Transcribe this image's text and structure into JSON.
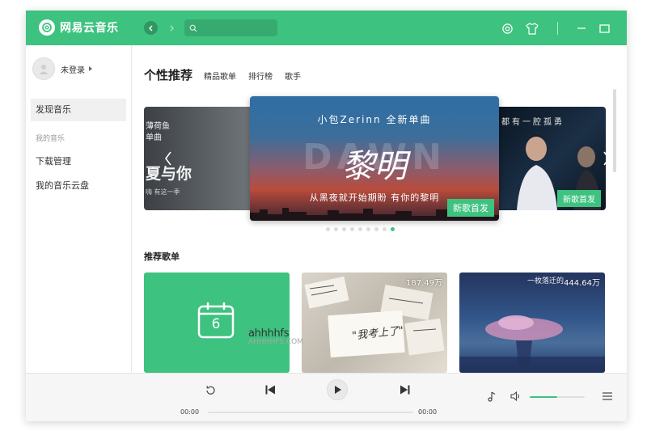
{
  "app": {
    "title": "网易云音乐"
  },
  "search": {
    "placeholder": ""
  },
  "sidebar": {
    "user_label": "未登录",
    "items": [
      {
        "label": "发现音乐"
      },
      {
        "label": "下载管理"
      },
      {
        "label": "我的音乐云盘"
      }
    ],
    "section_label": "我的音乐"
  },
  "main": {
    "tabs": [
      {
        "label": "个性推荐"
      },
      {
        "label": "精品歌单"
      },
      {
        "label": "排行榜"
      },
      {
        "label": "歌手"
      }
    ],
    "banner": {
      "left": {
        "line1": "薄荷鱼",
        "line2": "单曲",
        "title": "夏与你",
        "subtitle": "嗨 有这一季"
      },
      "center": {
        "headline": "小包Zerinn  全新单曲",
        "title": "黎明",
        "subtitle": "从黑夜就开始期盼  有你的黎明",
        "bg_word": "DAWN",
        "tag": "新歌首发"
      },
      "right": {
        "headline": "人都有一腔孤勇",
        "tag": "新歌首发"
      },
      "dot_count": 9,
      "active_dot": 8
    },
    "section_title": "推荐歌单",
    "cards": [
      {
        "type": "daily",
        "day": "6"
      },
      {
        "type": "playlist",
        "playcount": "187.49万",
        "handwriting": "\"我考上了\""
      },
      {
        "type": "playlist",
        "playcount": "444.64万",
        "caption": "一枚落迁的"
      }
    ]
  },
  "player": {
    "elapsed": "00:00",
    "duration": "00:00",
    "volume": 0.5
  },
  "watermark": {
    "line1": "ahhhhfs",
    "line2": "AHHHHFS.COM"
  },
  "colors": {
    "accent": "#3ec27f",
    "player_bg": "#f6f6f6"
  },
  "icons": [
    "logo-icon",
    "back-icon",
    "forward-icon",
    "search-icon",
    "settings-icon",
    "skin-icon",
    "minimize-icon",
    "maximize-icon",
    "repeat-icon",
    "previous-icon",
    "play-icon",
    "next-icon",
    "lyrics-icon",
    "volume-icon",
    "playlist-icon",
    "calendar-icon"
  ]
}
